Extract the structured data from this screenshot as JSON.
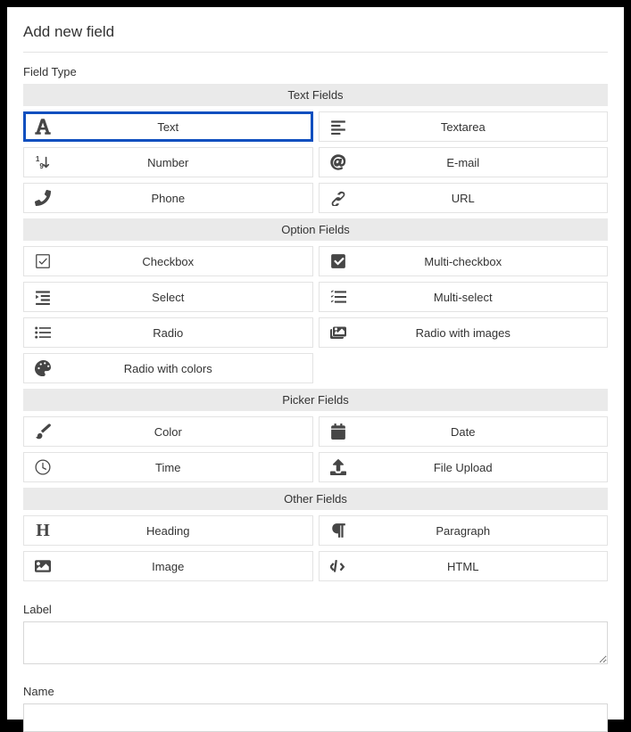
{
  "title": "Add new field",
  "fieldTypeLabel": "Field Type",
  "groups": {
    "text": {
      "header": "Text Fields",
      "items": [
        {
          "label": "Text"
        },
        {
          "label": "Textarea"
        },
        {
          "label": "Number"
        },
        {
          "label": "E-mail"
        },
        {
          "label": "Phone"
        },
        {
          "label": "URL"
        }
      ]
    },
    "option": {
      "header": "Option Fields",
      "items": [
        {
          "label": "Checkbox"
        },
        {
          "label": "Multi-checkbox"
        },
        {
          "label": "Select"
        },
        {
          "label": "Multi-select"
        },
        {
          "label": "Radio"
        },
        {
          "label": "Radio with images"
        },
        {
          "label": "Radio with colors"
        }
      ]
    },
    "picker": {
      "header": "Picker Fields",
      "items": [
        {
          "label": "Color"
        },
        {
          "label": "Date"
        },
        {
          "label": "Time"
        },
        {
          "label": "File Upload"
        }
      ]
    },
    "other": {
      "header": "Other Fields",
      "items": [
        {
          "label": "Heading"
        },
        {
          "label": "Paragraph"
        },
        {
          "label": "Image"
        },
        {
          "label": "HTML"
        }
      ]
    }
  },
  "form": {
    "labelLabel": "Label",
    "labelValue": "",
    "nameLabel": "Name",
    "nameValue": ""
  },
  "selected": "Text"
}
